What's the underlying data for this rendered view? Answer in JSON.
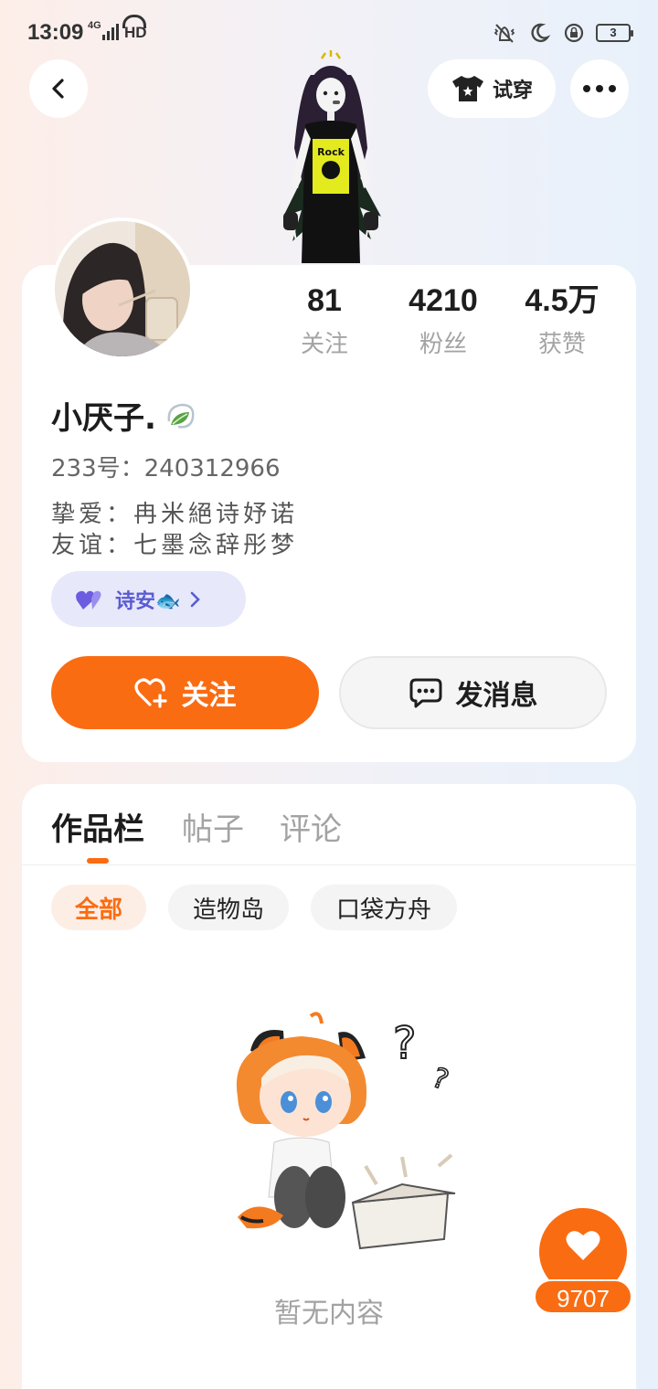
{
  "status_bar": {
    "time": "13:09",
    "network": "4G",
    "hd": "HD",
    "battery": "3"
  },
  "header": {
    "tryon_label": "试穿"
  },
  "profile": {
    "stats": [
      {
        "value": "81",
        "label": "关注"
      },
      {
        "value": "4210",
        "label": "粉丝"
      },
      {
        "value": "4.5万",
        "label": "获赞"
      }
    ],
    "username": "小厌子.",
    "uid": "233号：240312966",
    "relations": [
      "挚爱：冉米絕诗妤诺",
      "友谊：七墨念辞彤梦"
    ],
    "cp_name": "诗安🐟",
    "follow_label": "关注",
    "message_label": "发消息"
  },
  "works": {
    "tabs": [
      "作品栏",
      "帖子",
      "评论"
    ],
    "filters": [
      "全部",
      "造物岛",
      "口袋方舟"
    ],
    "empty_text": "暂无内容"
  },
  "like_fab": {
    "count": "9707"
  },
  "colors": {
    "accent": "#fa6c12",
    "cp_purple": "#5a5bd2"
  }
}
